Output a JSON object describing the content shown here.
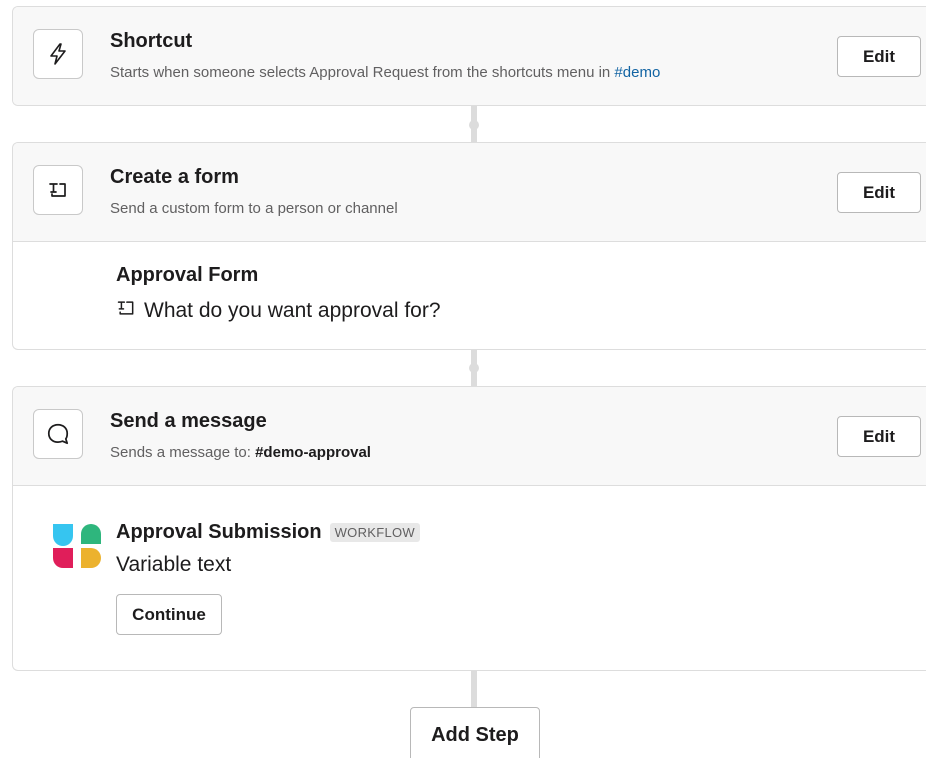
{
  "steps": {
    "shortcut": {
      "icon": "lightning-icon",
      "title": "Shortcut",
      "subtitle_prefix": "Starts when someone selects Approval Request from the shortcuts menu in ",
      "channel": "#demo",
      "edit_label": "Edit"
    },
    "form": {
      "icon": "form-icon",
      "title": "Create a form",
      "subtitle": "Send a custom form to a person or channel",
      "edit_label": "Edit",
      "form_name": "Approval Form",
      "question_icon": "form-field-icon",
      "question": "What do you want approval for?"
    },
    "message": {
      "icon": "message-bubble-icon",
      "title": "Send a message",
      "subtitle_prefix": "Sends a message to: ",
      "channel": "#demo-approval",
      "edit_label": "Edit",
      "preview": {
        "logo_icon": "slack-logo-icon",
        "title": "Approval Submission",
        "badge": "WORKFLOW",
        "text": "Variable text",
        "button_label": "Continue"
      }
    }
  },
  "add_step_label": "Add Step",
  "colors": {
    "link": "#1264a3",
    "header_bg": "#f8f8f8",
    "border": "#dddddd",
    "connector": "#dcdcdc",
    "logo_blue": "#36c5f0",
    "logo_green": "#2eb67d",
    "logo_red": "#e01e5a",
    "logo_yellow": "#ecb22e"
  }
}
